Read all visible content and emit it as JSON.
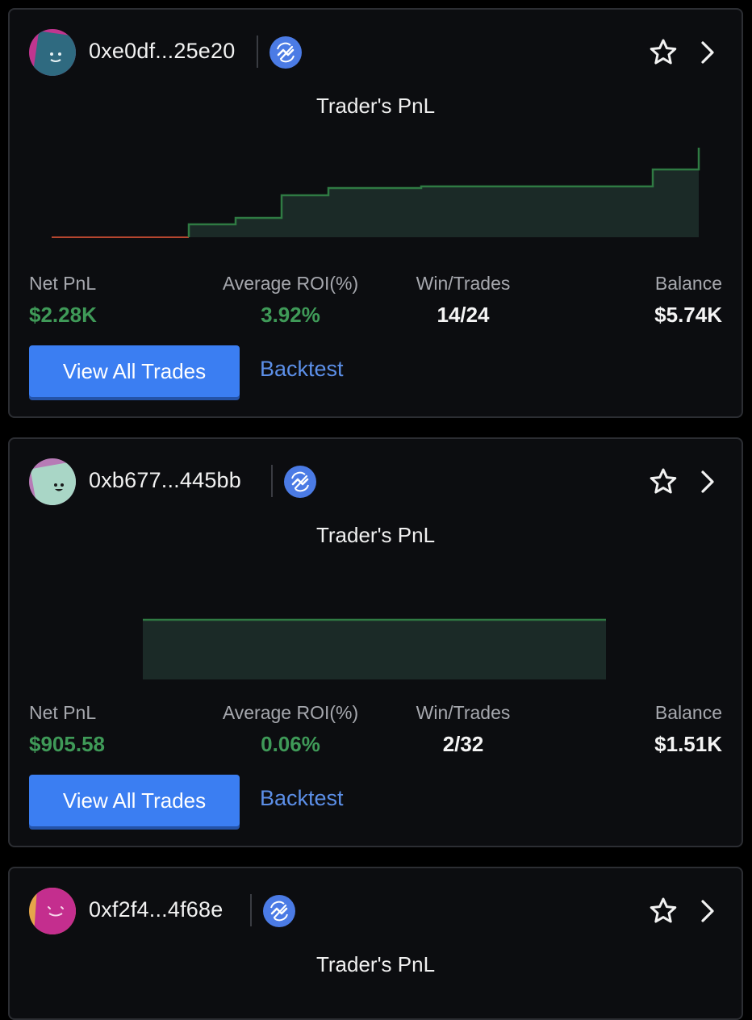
{
  "actions": {
    "view_all_label": "View All Trades",
    "backtest_label": "Backtest"
  },
  "colors": {
    "accent": "#3b7ef2",
    "positive": "#3f9a58",
    "negative": "#b5462f",
    "chain": "#4b7be5"
  },
  "cards": [
    {
      "address": "0xe0df...25e20",
      "avatar_colors": [
        "#c0358f",
        "#2f6a80"
      ],
      "chart_title": "Trader's PnL",
      "stats": [
        {
          "label": "Net PnL",
          "value": "$2.28K"
        },
        {
          "label": "Average ROI(%)",
          "value": "3.92%"
        },
        {
          "label": "Win/Trades",
          "value": "14/24"
        },
        {
          "label": "Balance",
          "value": "$5.74K"
        }
      ]
    },
    {
      "address": "0xb677...445bb",
      "avatar_colors": [
        "#b77bb6",
        "#a9d6c6"
      ],
      "chart_title": "Trader's PnL",
      "stats": [
        {
          "label": "Net PnL",
          "value": "$905.58"
        },
        {
          "label": "Average ROI(%)",
          "value": "0.06%"
        },
        {
          "label": "Win/Trades",
          "value": "2/32"
        },
        {
          "label": "Balance",
          "value": "$1.51K"
        }
      ]
    },
    {
      "address": "0xf2f4...4f68e",
      "avatar_colors": [
        "#e5a54a",
        "#c42e8e"
      ],
      "chart_title": "Trader's PnL"
    }
  ]
}
